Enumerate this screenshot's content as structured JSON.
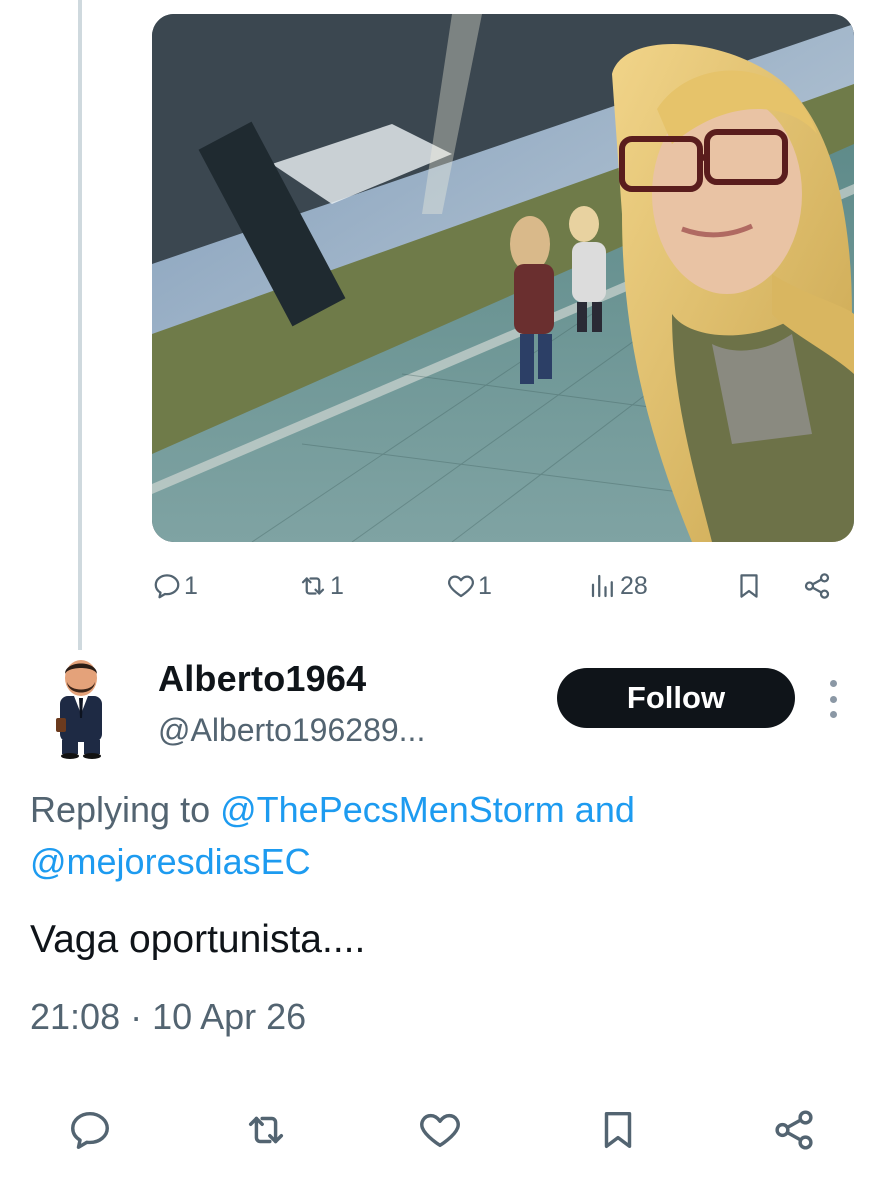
{
  "top_actions": {
    "reply_count": "1",
    "repost_count": "1",
    "like_count": "1",
    "views_count": "28"
  },
  "author": {
    "name": "Alberto1964",
    "handle": "@Alberto196289..."
  },
  "follow_label": "Follow",
  "replying": {
    "prefix": "Replying to",
    "mention1": "@ThePecsMenStorm",
    "conjunction": "and",
    "mention2": "@mejoresdiasEC"
  },
  "tweet": {
    "text": "Vaga oportunista....",
    "timestamp": "21:08 · 10 Apr 26"
  },
  "icons": {
    "reply": "reply-icon",
    "repost": "repost-icon",
    "like": "heart-icon",
    "views": "views-icon",
    "bookmark": "bookmark-icon",
    "share": "share-icon",
    "more": "more-icon"
  },
  "colors": {
    "accent": "#1d9bf0",
    "text": "#0f1419",
    "muted": "#536471",
    "follow_bg": "#0f1419"
  }
}
